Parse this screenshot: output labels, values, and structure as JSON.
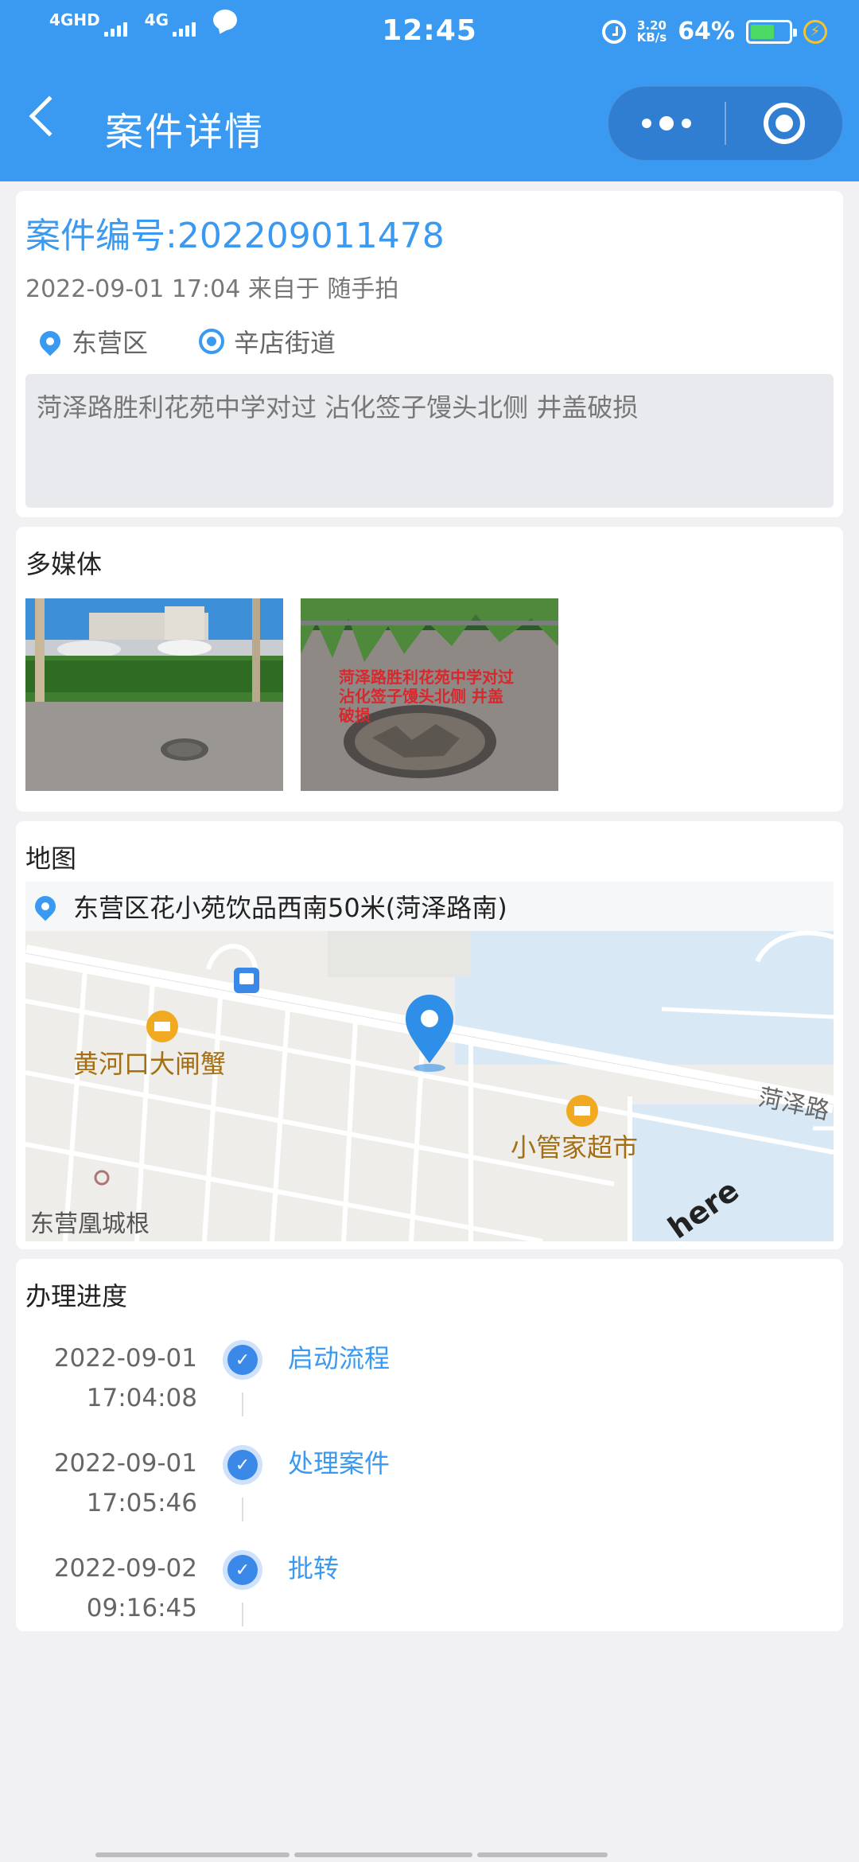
{
  "status_bar": {
    "signal1_label": "4GHD",
    "signal2_label": "4G",
    "time": "12:45",
    "net_speed_value": "3.20",
    "net_speed_unit": "KB/s",
    "battery_pct": "64%",
    "battery_level": 0.64
  },
  "nav": {
    "title": "案件详情"
  },
  "case": {
    "number": "案件编号:202209011478",
    "meta": "2022-09-01 17:04 来自于 随手拍",
    "district": "东营区",
    "street": "辛店街道",
    "description": "菏泽路胜利花苑中学对过 沾化签子馒头北侧 井盖破损"
  },
  "media": {
    "title": "多媒体",
    "photo_overlay_line1": "菏泽路胜利花苑中学对过",
    "photo_overlay_line2": "沾化签子馒头北侧  井盖",
    "photo_overlay_line3": "破损"
  },
  "map": {
    "title": "地图",
    "address": "东营区花小苑饮品西南50米(菏泽路南)",
    "poi1": "黄河口大闸蟹",
    "poi2": "小管家超市",
    "poi3": "东营凰城根",
    "road": "菏泽路",
    "watermark": "here"
  },
  "progress": {
    "title": "办理进度",
    "steps": [
      {
        "date": "2022-09-01",
        "time": "17:04:08",
        "label": "启动流程"
      },
      {
        "date": "2022-09-01",
        "time": "17:05:46",
        "label": "处理案件"
      },
      {
        "date": "2022-09-02",
        "time": "09:16:45",
        "label": "批转"
      }
    ]
  },
  "colors": {
    "primary": "#3a99f0",
    "page_bg": "#f1f1f3"
  }
}
